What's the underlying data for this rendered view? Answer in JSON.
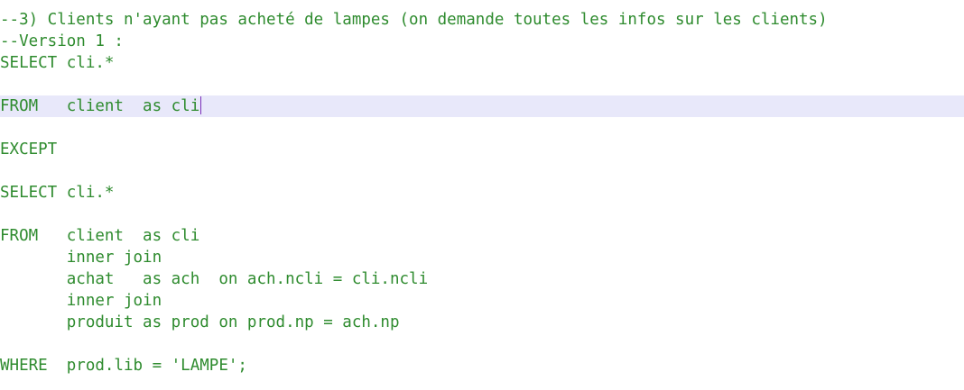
{
  "editor": {
    "lines": [
      "--3) Clients n'ayant pas acheté de lampes (on demande toutes les infos sur les clients)",
      "--Version 1 :",
      "SELECT cli.*",
      "",
      "FROM   client  as cli",
      "",
      "EXCEPT",
      "",
      "SELECT cli.*",
      "",
      "FROM   client  as cli",
      "       inner join",
      "       achat   as ach  on ach.ncli = cli.ncli",
      "       inner join",
      "       produit as prod on prod.np = ach.np",
      "",
      "WHERE  prod.lib = 'LAMPE';"
    ],
    "current_line": 5,
    "text_color": "#2e8b2e",
    "current_line_color": "#e8e8fa",
    "caret_color": "#7a2fb8"
  }
}
